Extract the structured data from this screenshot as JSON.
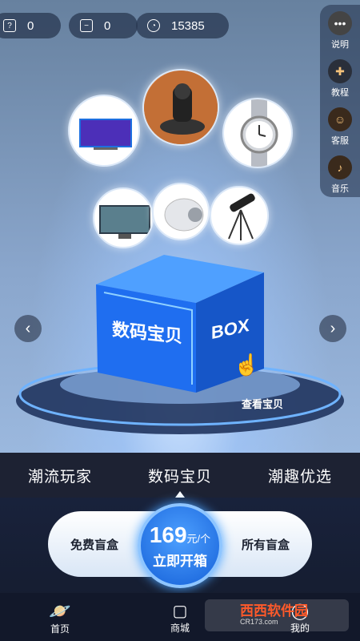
{
  "topbar": {
    "stats": [
      {
        "icon": "question-box-icon",
        "value": "0"
      },
      {
        "icon": "box-icon",
        "value": "0"
      },
      {
        "icon": "coin-icon",
        "value": "15385"
      }
    ]
  },
  "sidebar": {
    "items": [
      {
        "icon": "more-icon",
        "label": "说明"
      },
      {
        "icon": "gamepad-icon",
        "label": "教程"
      },
      {
        "icon": "support-icon",
        "label": "客服"
      },
      {
        "icon": "music-icon",
        "label": "音乐"
      }
    ]
  },
  "stage": {
    "box_title": "数码宝贝",
    "box_side_text": "BOX",
    "view_label": "查看宝贝"
  },
  "tabs": {
    "items": [
      "潮流玩家",
      "数码宝贝",
      "潮趣优选"
    ],
    "active": 1
  },
  "action": {
    "left_label": "免费盲盒",
    "right_label": "所有盲盒",
    "price": "169",
    "price_unit": "元/个",
    "open_label": "立即开箱"
  },
  "nav": {
    "items": [
      "首页",
      "商城",
      "我的"
    ]
  },
  "watermark": {
    "brand": "西西软件园",
    "url": "CR173.com"
  },
  "colors": {
    "accent": "#1c7cff",
    "tab_bg": "#1d2233",
    "nav_bg": "#12182a"
  }
}
